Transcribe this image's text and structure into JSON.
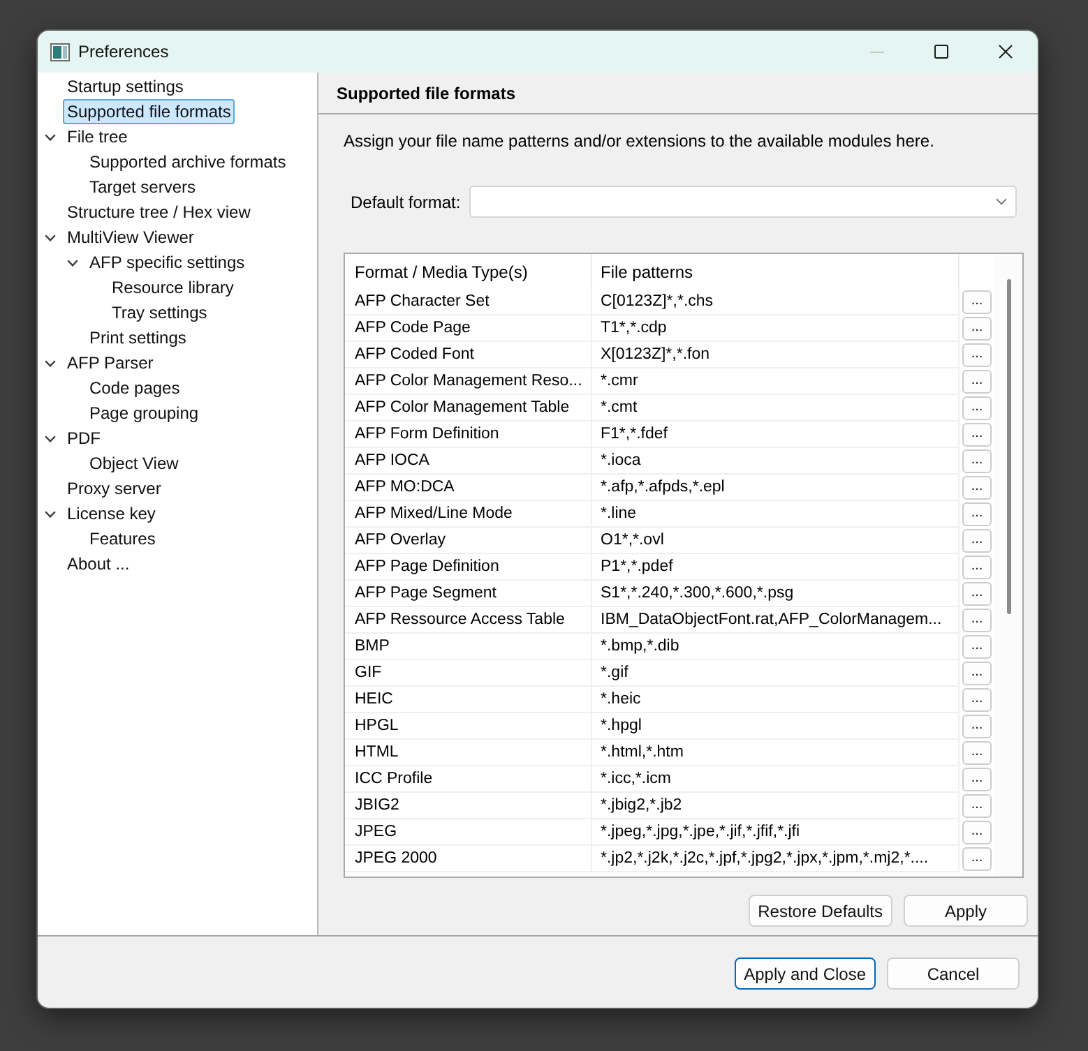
{
  "window": {
    "title": "Preferences",
    "controls": [
      {
        "kind": "minimize",
        "disabled": true
      },
      {
        "kind": "maximize",
        "disabled": false
      },
      {
        "kind": "close",
        "disabled": false
      }
    ]
  },
  "sidebar": {
    "items": [
      {
        "label": "Startup settings",
        "selected": false
      },
      {
        "label": "Supported file formats",
        "selected": true
      },
      {
        "label": "File tree",
        "selected": false,
        "expanded": true,
        "children": [
          {
            "label": "Supported archive formats",
            "selected": false
          },
          {
            "label": "Target servers",
            "selected": false
          }
        ]
      },
      {
        "label": "Structure tree / Hex view",
        "selected": false
      },
      {
        "label": "MultiView Viewer",
        "selected": false,
        "expanded": true,
        "children": [
          {
            "label": "AFP specific settings",
            "selected": false,
            "expanded": true,
            "children": [
              {
                "label": "Resource library",
                "selected": false
              },
              {
                "label": "Tray settings",
                "selected": false
              }
            ]
          },
          {
            "label": "Print settings",
            "selected": false
          }
        ]
      },
      {
        "label": "AFP Parser",
        "selected": false,
        "expanded": true,
        "children": [
          {
            "label": "Code pages",
            "selected": false
          },
          {
            "label": "Page grouping",
            "selected": false
          }
        ]
      },
      {
        "label": "PDF",
        "selected": false,
        "expanded": true,
        "children": [
          {
            "label": "Object View",
            "selected": false
          }
        ]
      },
      {
        "label": "Proxy server",
        "selected": false
      },
      {
        "label": "License key",
        "selected": false,
        "expanded": true,
        "children": [
          {
            "label": "Features",
            "selected": false
          }
        ]
      },
      {
        "label": "About ...",
        "selected": false
      }
    ]
  },
  "page": {
    "title": "Supported file formats",
    "description": "Assign your file name patterns and/or extensions to the available modules here.",
    "default_format": {
      "label": "Default format:"
    },
    "table": {
      "columns": [
        "Format / Media Type(s)",
        "File patterns"
      ],
      "rows": [
        {
          "format": "AFP Character Set",
          "patterns": "C[0123Z]*,*.chs",
          "button": "..."
        },
        {
          "format": "AFP Code Page",
          "patterns": "T1*,*.cdp",
          "button": "..."
        },
        {
          "format": "AFP Coded Font",
          "patterns": "X[0123Z]*,*.fon",
          "button": "..."
        },
        {
          "format": "AFP Color Management Reso...",
          "patterns": "*.cmr",
          "button": "..."
        },
        {
          "format": "AFP Color Management Table",
          "patterns": "*.cmt",
          "button": "..."
        },
        {
          "format": "AFP Form Definition",
          "patterns": "F1*,*.fdef",
          "button": "..."
        },
        {
          "format": "AFP IOCA",
          "patterns": "*.ioca",
          "button": "..."
        },
        {
          "format": "AFP MO:DCA",
          "patterns": "*.afp,*.afpds,*.epl",
          "button": "..."
        },
        {
          "format": "AFP Mixed/Line Mode",
          "patterns": "*.line",
          "button": "..."
        },
        {
          "format": "AFP Overlay",
          "patterns": "O1*,*.ovl",
          "button": "..."
        },
        {
          "format": "AFP Page Definition",
          "patterns": "P1*,*.pdef",
          "button": "..."
        },
        {
          "format": "AFP Page Segment",
          "patterns": "S1*,*.240,*.300,*.600,*.psg",
          "button": "..."
        },
        {
          "format": "AFP Ressource Access Table",
          "patterns": "IBM_DataObjectFont.rat,AFP_ColorManagem...",
          "button": "..."
        },
        {
          "format": "BMP",
          "patterns": "*.bmp,*.dib",
          "button": "..."
        },
        {
          "format": "GIF",
          "patterns": "*.gif",
          "button": "..."
        },
        {
          "format": "HEIC",
          "patterns": "*.heic",
          "button": "..."
        },
        {
          "format": "HPGL",
          "patterns": "*.hpgl",
          "button": "..."
        },
        {
          "format": "HTML",
          "patterns": "*.html,*.htm",
          "button": "..."
        },
        {
          "format": "ICC Profile",
          "patterns": "*.icc,*.icm",
          "button": "..."
        },
        {
          "format": "JBIG2",
          "patterns": "*.jbig2,*.jb2",
          "button": "..."
        },
        {
          "format": "JPEG",
          "patterns": "*.jpeg,*.jpg,*.jpe,*.jif,*.jfif,*.jfi",
          "button": "..."
        },
        {
          "format": "JPEG 2000",
          "patterns": "*.jp2,*.j2k,*.j2c,*.jpf,*.jpg2,*.jpx,*.jpm,*.mj2,*....",
          "button": "..."
        }
      ]
    },
    "buttons": [
      {
        "label": "Restore Defaults"
      },
      {
        "label": "Apply"
      }
    ]
  },
  "dialog_buttons": [
    {
      "label": "Apply and Close",
      "focused": true
    },
    {
      "label": "Cancel",
      "focused": false
    }
  ]
}
